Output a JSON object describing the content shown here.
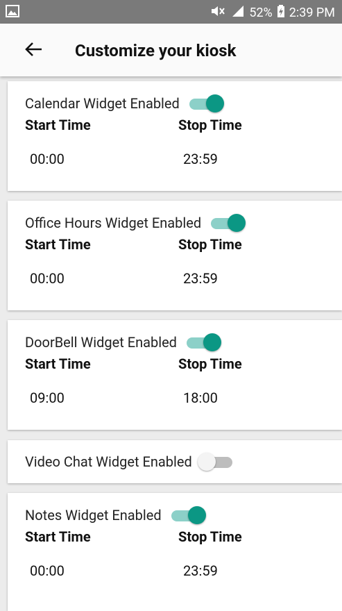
{
  "status_bar": {
    "battery": "52%",
    "time": "2:39 PM"
  },
  "header": {
    "title": "Customize your kiosk"
  },
  "widgets": [
    {
      "label": "Calendar Widget Enabled",
      "enabled": true,
      "start_label": "Start Time",
      "stop_label": "Stop Time",
      "start": "00:00",
      "stop": "23:59"
    },
    {
      "label": "Office Hours Widget Enabled",
      "enabled": true,
      "start_label": "Start Time",
      "stop_label": "Stop Time",
      "start": "00:00",
      "stop": "23:59"
    },
    {
      "label": "DoorBell Widget Enabled",
      "enabled": true,
      "start_label": "Start Time",
      "stop_label": "Stop Time",
      "start": "09:00",
      "stop": "18:00"
    },
    {
      "label": "Video Chat Widget Enabled",
      "enabled": false
    },
    {
      "label": "Notes Widget Enabled",
      "enabled": true,
      "start_label": "Start Time",
      "stop_label": "Stop Time",
      "start": "00:00",
      "stop": "23:59"
    }
  ],
  "colors": {
    "accent": "#0b9784",
    "accent_track": "#8cd0c8"
  }
}
